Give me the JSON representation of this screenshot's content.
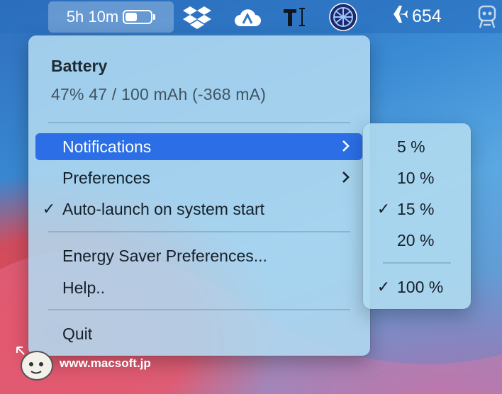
{
  "menubar": {
    "battery_time": "5h 10m",
    "battery_level_fraction": 0.47,
    "icons": [
      "dropbox-icon",
      "cloud-app-icon",
      "text-cursor-icon",
      "globe-app-icon",
      "airplane-icon",
      "robot-icon"
    ],
    "flight_count": "654"
  },
  "menu": {
    "title": "Battery",
    "detail": "47%   47 / 100 mAh (-368 mA)",
    "items": [
      {
        "label": "Notifications",
        "checked": false,
        "submenu": true,
        "highlighted": true
      },
      {
        "label": "Preferences",
        "checked": false,
        "submenu": true
      },
      {
        "label": "Auto-launch on system start",
        "checked": true,
        "submenu": false
      },
      {
        "label": "Energy Saver Preferences...",
        "checked": false,
        "submenu": false
      },
      {
        "label": "Help..",
        "checked": false,
        "submenu": false
      },
      {
        "label": "Quit",
        "checked": false,
        "submenu": false
      }
    ],
    "check_glyph": "✓",
    "chevron_glyph": "›"
  },
  "submenu": {
    "items": [
      {
        "label": "5 %",
        "checked": false
      },
      {
        "label": "10 %",
        "checked": false
      },
      {
        "label": "15 %",
        "checked": true
      },
      {
        "label": "20 %",
        "checked": false
      },
      {
        "label": "100 %",
        "checked": true
      }
    ]
  },
  "watermark": {
    "text": "www.macsoft.jp"
  },
  "colors": {
    "highlight": "#2b6ee6",
    "menubar": "#2f78c4"
  }
}
